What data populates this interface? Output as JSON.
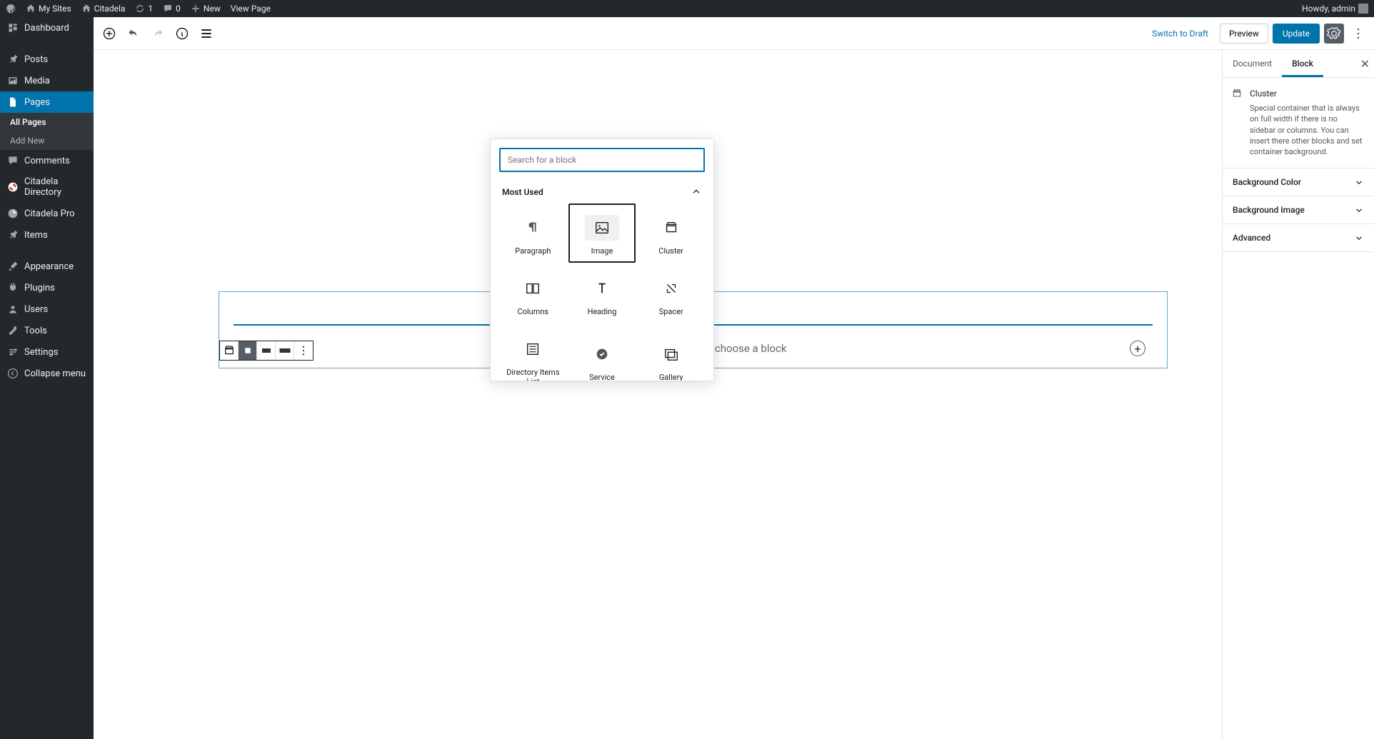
{
  "adminbar": {
    "mysites": "My Sites",
    "sitename": "Citadela",
    "updates": "1",
    "comments": "0",
    "new": "New",
    "viewpage": "View Page",
    "howdy": "Howdy, admin"
  },
  "sidebar": {
    "dashboard": "Dashboard",
    "posts": "Posts",
    "media": "Media",
    "pages": "Pages",
    "allpages": "All Pages",
    "addnew": "Add New",
    "comments": "Comments",
    "citadeladir": "Citadela Directory",
    "citadelapro": "Citadela Pro",
    "items": "Items",
    "appearance": "Appearance",
    "plugins": "Plugins",
    "users": "Users",
    "tools": "Tools",
    "settings": "Settings",
    "collapse": "Collapse menu"
  },
  "header": {
    "switch": "Switch to Draft",
    "preview": "Preview",
    "update": "Update"
  },
  "inserter": {
    "search_placeholder": "Search for a block",
    "cat_mostused": "Most Used",
    "blocks": {
      "paragraph": "Paragraph",
      "image": "Image",
      "cluster": "Cluster",
      "columns": "Columns",
      "heading": "Heading",
      "spacer": "Spacer",
      "diritems": "Directory Items List",
      "service": "Service",
      "gallery": "Gallery"
    }
  },
  "canvas": {
    "placeholder": "Start writing or type / to choose a block"
  },
  "settings": {
    "tab_document": "Document",
    "tab_block": "Block",
    "block_title": "Cluster",
    "block_desc": "Special container that is always on full width if there is no sidebar or columns. You can insert there other blocks and set container background.",
    "panel_bgcolor": "Background Color",
    "panel_bgimage": "Background Image",
    "panel_advanced": "Advanced"
  }
}
